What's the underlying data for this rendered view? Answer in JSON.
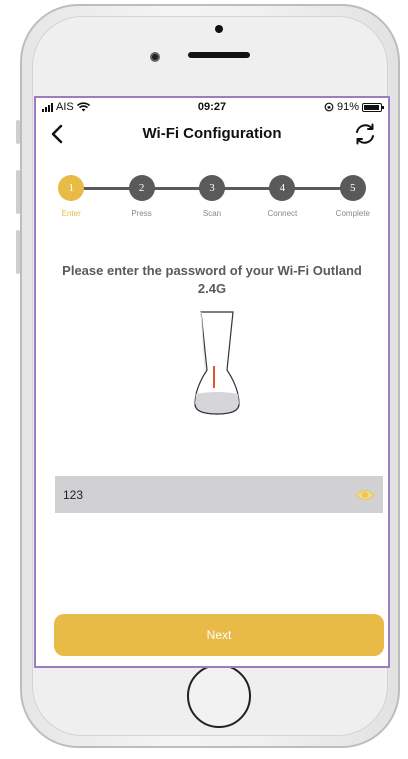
{
  "statusbar": {
    "carrier": "AIS",
    "time": "09:27",
    "battery_text": "91%",
    "battery_level": 0.91
  },
  "navbar": {
    "title": "Wi-Fi Configuration",
    "back_icon": "chevron-left-icon",
    "refresh_icon": "refresh-icon"
  },
  "steps": [
    {
      "number": "1",
      "label": "Enter",
      "active": true
    },
    {
      "number": "2",
      "label": "Press",
      "active": false
    },
    {
      "number": "3",
      "label": "Scan",
      "active": false
    },
    {
      "number": "4",
      "label": "Connect",
      "active": false
    },
    {
      "number": "5",
      "label": "Complete",
      "active": false
    }
  ],
  "prompt": "Please enter the password of your Wi-Fi Outland 2.4G",
  "password": {
    "value": "123",
    "toggle_icon": "eye-icon"
  },
  "next_label": "Next",
  "colors": {
    "accent": "#e8bb47",
    "step_inactive": "#5a5a5a",
    "field_bg": "#d1d1d3",
    "screen_border": "#9e7cc2"
  }
}
